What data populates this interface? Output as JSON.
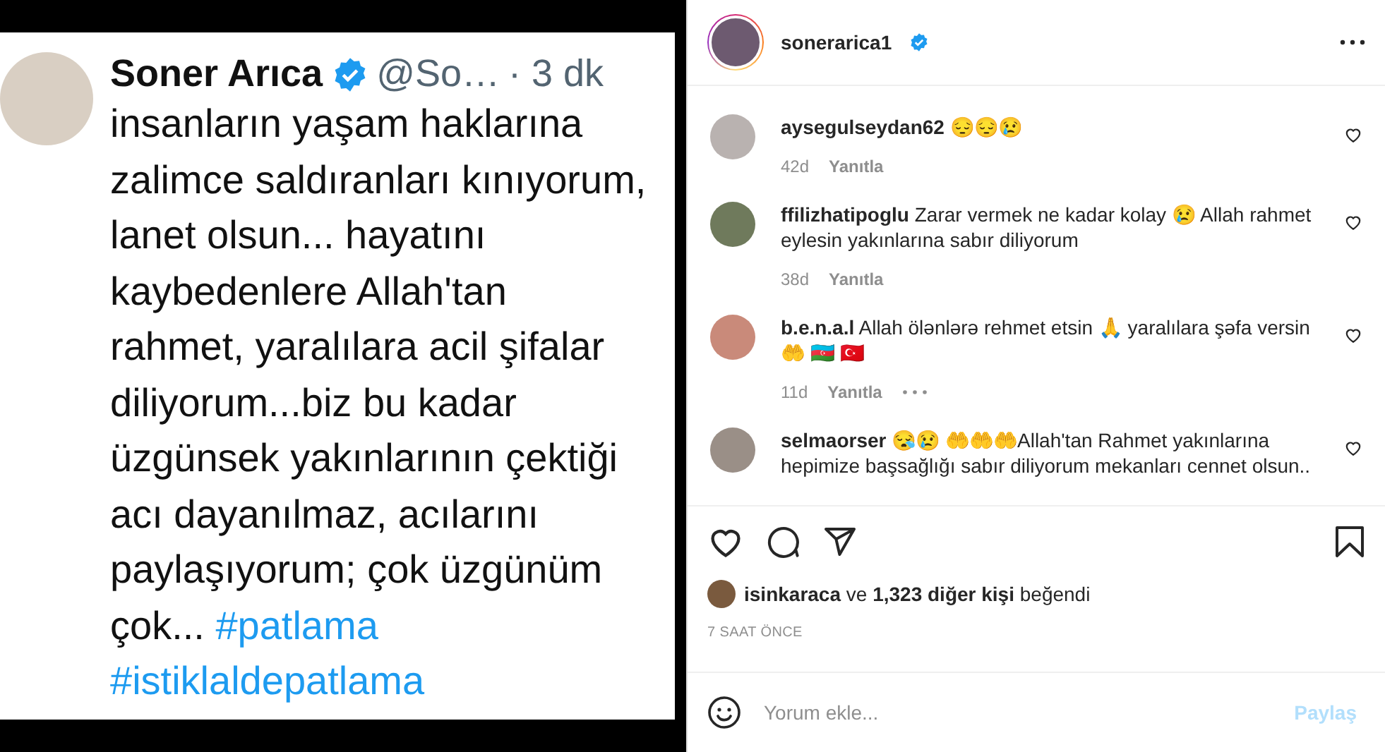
{
  "tweet": {
    "name": "Soner Arıca",
    "verified": true,
    "handle": "@So…",
    "time": "· 3 dk",
    "lines": [
      [
        {
          "kind": "text",
          "text": "insanların yaşam haklarına"
        }
      ],
      [
        {
          "kind": "text",
          "text": "zalimce saldıranları kınıyorum,"
        }
      ],
      [
        {
          "kind": "text",
          "text": "lanet olsun... hayatını"
        }
      ],
      [
        {
          "kind": "text",
          "text": "kaybedenlere Allah'tan"
        }
      ],
      [
        {
          "kind": "text",
          "text": "rahmet, yaralılara acil şifalar"
        }
      ],
      [
        {
          "kind": "text",
          "text": "diliyorum...biz bu kadar"
        }
      ],
      [
        {
          "kind": "text",
          "text": "üzgünsek yakınlarının çektiği"
        }
      ],
      [
        {
          "kind": "text",
          "text": "acı dayanılmaz, acılarını"
        }
      ],
      [
        {
          "kind": "text",
          "text": "paylaşıyorum; çok üzgünüm"
        }
      ],
      [
        {
          "kind": "text",
          "text": "çok... "
        },
        {
          "kind": "hashtag",
          "text": "#patlama"
        }
      ],
      [
        {
          "kind": "hashtag",
          "text": "#istiklaldepatlama"
        }
      ]
    ]
  },
  "post": {
    "username": "sonerarica1",
    "verified": true,
    "comments": [
      {
        "username": "aysegulseydan62",
        "text": "😔😔😢",
        "time": "42d",
        "reply": "Yanıtla",
        "options": false,
        "liked": false
      },
      {
        "username": "ffilizhatipoglu",
        "text": "Zarar vermek ne kadar kolay 😢 Allah rahmet eylesin yakınlarına sabır diliyorum",
        "time": "38d",
        "reply": "Yanıtla",
        "options": false,
        "liked": false
      },
      {
        "username": "b.e.n.a.l",
        "text": "Allah ölənlərə rehmet etsin 🙏 yaralılara şəfa versin 🤲 🇦🇿 🇹🇷",
        "time": "11d",
        "reply": "Yanıtla",
        "options": true,
        "liked": false
      },
      {
        "username": "selmaorser",
        "text": "😪😢 🤲🤲🤲Allah'tan Rahmet yakınlarına hepimize başsağlığı sabır diliyorum mekanları cennet olsun..",
        "liked": false
      }
    ],
    "liked": false,
    "saved": false,
    "likes": {
      "first": "isinkaraca",
      "joiner": "ve",
      "count": "1,323 diğer kişi",
      "suffix": "beğendi"
    },
    "timestamp": "7 SAAT ÖNCE",
    "comment_box": {
      "placeholder": "Yorum ekle...",
      "submit": "Paylaş"
    }
  }
}
